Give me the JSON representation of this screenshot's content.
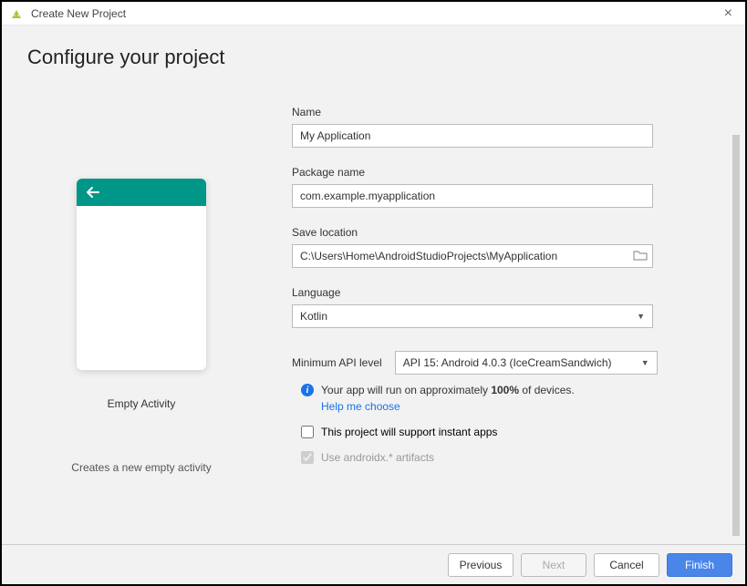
{
  "window": {
    "title": "Create New Project"
  },
  "page_title": "Configure your project",
  "preview": {
    "label": "Empty Activity",
    "description": "Creates a new empty activity"
  },
  "form": {
    "name": {
      "label": "Name",
      "value": "My Application"
    },
    "package": {
      "label": "Package name",
      "value": "com.example.myapplication"
    },
    "save_location": {
      "label": "Save location",
      "value": "C:\\Users\\Home\\AndroidStudioProjects\\MyApplication"
    },
    "language": {
      "label": "Language",
      "value": "Kotlin"
    },
    "api_level": {
      "label": "Minimum API level",
      "value": "API 15: Android 4.0.3 (IceCreamSandwich)"
    },
    "coverage_prefix": "Your app will run on approximately ",
    "coverage_bold": "100%",
    "coverage_suffix": " of devices.",
    "help_link": "Help me choose",
    "instant_apps": {
      "label": "This project will support instant apps",
      "checked": false
    },
    "androidx": {
      "label": "Use androidx.* artifacts",
      "checked": true
    }
  },
  "buttons": {
    "previous": "Previous",
    "next": "Next",
    "cancel": "Cancel",
    "finish": "Finish"
  }
}
